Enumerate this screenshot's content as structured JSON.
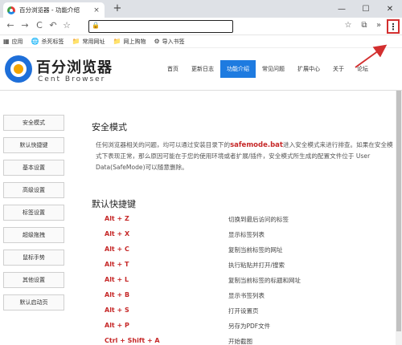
{
  "tab": {
    "title": "百分浏览器 - 功能介绍",
    "close": "×",
    "new_tab": "+"
  },
  "window": {
    "minimize": "—",
    "maximize": "☐",
    "close": "✕"
  },
  "toolbar": {
    "back": "←",
    "forward": "→",
    "reload": "C",
    "undo": "↶",
    "star": "☆",
    "address_value": "",
    "lock": "🔒",
    "star_right": "☆",
    "crop": "⧉",
    "more": "»",
    "menu": "⋮"
  },
  "bookmarks": [
    {
      "icon": "▦",
      "label": "应用"
    },
    {
      "icon": "🌐",
      "label": "杀死标签"
    },
    {
      "icon": "📁",
      "label": "常用网址"
    },
    {
      "icon": "📁",
      "label": "网上购物"
    },
    {
      "icon": "⚙",
      "label": "导入书签"
    }
  ],
  "site": {
    "brand_cn": "百分浏览器",
    "brand_en": "Cent Browser",
    "nav": [
      "首页",
      "更新日志",
      "功能介绍",
      "常见问题",
      "扩展中心",
      "关于",
      "论坛"
    ],
    "active_nav": "功能介绍"
  },
  "sidebar": [
    "安全模式",
    "默认快捷键",
    "基本设置",
    "高级设置",
    "标签设置",
    "超级拖拽",
    "鼠标手势",
    "其他设置",
    "默认启动页"
  ],
  "safe_mode": {
    "title": "安全模式",
    "text_before": "任何浏览器相关的问题，均可以通过安装目录下的",
    "highlight": "safemode.bat",
    "text_after": "进入安全模式来进行排查。如果在安全模式下表现正常，那么原因可能在于您的使用环境或者扩展/插件，安全模式所生成的配置文件位于 User Data(SafeMode)可以随意删除。"
  },
  "shortcuts": {
    "title": "默认快捷键",
    "rows": [
      {
        "key": "Alt + Z",
        "desc": "切换到最后访问的标签"
      },
      {
        "key": "Alt + X",
        "desc": "显示标签列表"
      },
      {
        "key": "Alt + C",
        "desc": "复制当前标签的网址"
      },
      {
        "key": "Alt + T",
        "desc": "执行粘贴并打开/搜索"
      },
      {
        "key": "Alt + L",
        "desc": "复制当前标签的标题和网址"
      },
      {
        "key": "Alt + B",
        "desc": "显示书签列表"
      },
      {
        "key": "Alt + S",
        "desc": "打开设置页"
      },
      {
        "key": "Alt + P",
        "desc": "另存为PDF文件"
      },
      {
        "key": "Ctrl + Shift + A",
        "desc": "开始截图"
      }
    ]
  },
  "colors": {
    "accent": "#1e7be0",
    "highlight": "#c62828",
    "annotation": "#d32f2f"
  }
}
